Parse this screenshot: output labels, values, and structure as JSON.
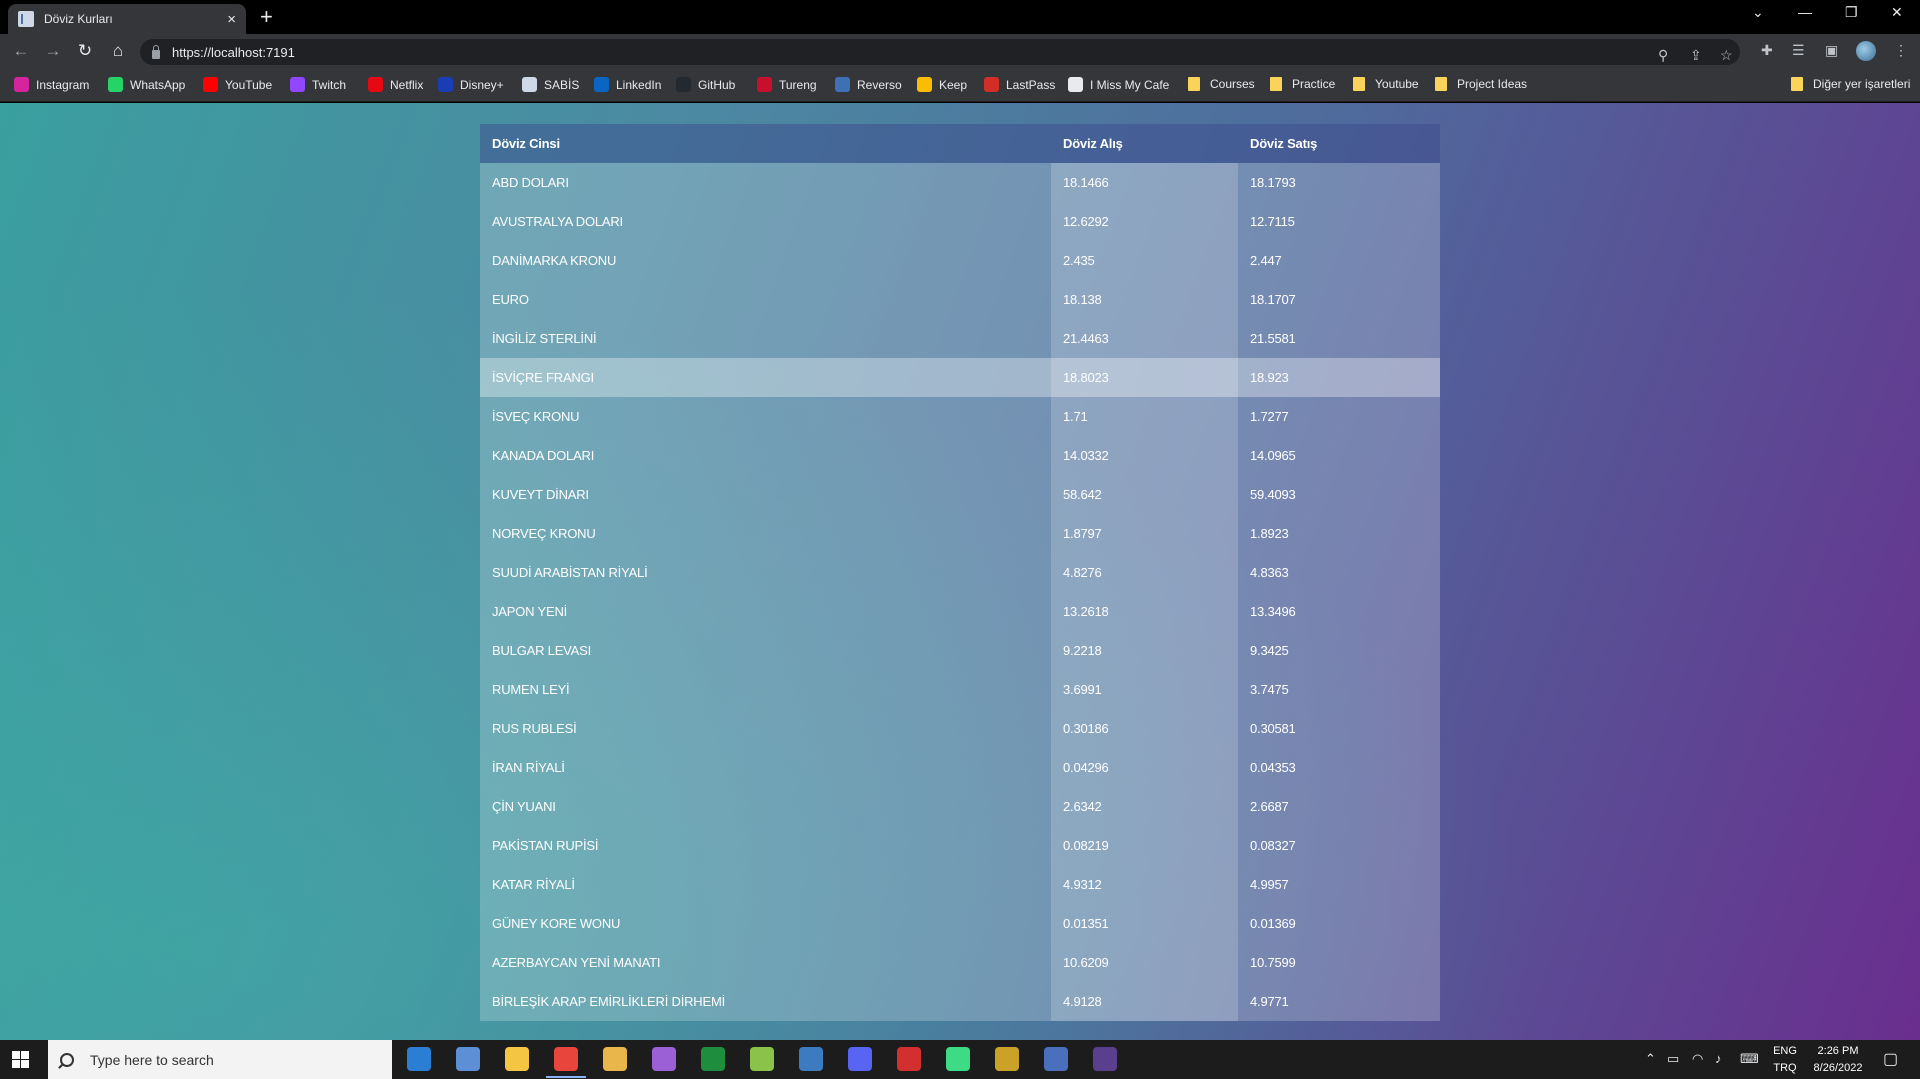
{
  "browser": {
    "tab_title": "Döviz Kurları",
    "tab_close": "×",
    "new_tab": "+",
    "url": "https://localhost:7191",
    "window_controls": {
      "dropdown": "⌄",
      "minimize": "—",
      "restore": "❐",
      "close": "✕"
    }
  },
  "bookmarks": [
    {
      "label": "Instagram",
      "icon": "instagram-icon",
      "color": "#d6249f"
    },
    {
      "label": "WhatsApp",
      "icon": "whatsapp-icon",
      "color": "#25d366"
    },
    {
      "label": "YouTube",
      "icon": "youtube-icon",
      "color": "#ff0000"
    },
    {
      "label": "Twitch",
      "icon": "twitch-icon",
      "color": "#9146ff"
    },
    {
      "label": "Netflix",
      "icon": "netflix-icon",
      "color": "#e50914"
    },
    {
      "label": "Disney+",
      "icon": "disney-icon",
      "color": "#1a3cb5"
    },
    {
      "label": "SABİS",
      "icon": "document-icon",
      "color": "#cfd8e6"
    },
    {
      "label": "LinkedIn",
      "icon": "linkedin-icon",
      "color": "#0a66c2"
    },
    {
      "label": "GitHub",
      "icon": "github-icon",
      "color": "#24292f"
    },
    {
      "label": "Tureng",
      "icon": "tureng-icon",
      "color": "#c8102e"
    },
    {
      "label": "Reverso",
      "icon": "reverso-icon",
      "color": "#3f6fb5"
    },
    {
      "label": "Keep",
      "icon": "keep-icon",
      "color": "#fbbc04"
    },
    {
      "label": "LastPass",
      "icon": "lastpass-icon",
      "color": "#d32d27"
    },
    {
      "label": "I Miss My Cafe",
      "icon": "cafe-icon",
      "color": "#e8eaed"
    },
    {
      "label": "Courses",
      "icon": "folder-icon",
      "color": "#f9d35a"
    },
    {
      "label": "Practice",
      "icon": "folder-icon",
      "color": "#f9d35a"
    },
    {
      "label": "Youtube",
      "icon": "folder-icon",
      "color": "#f9d35a"
    },
    {
      "label": "Project Ideas",
      "icon": "folder-icon",
      "color": "#f9d35a"
    }
  ],
  "other_bookmarks": "Diğer yer işaretleri",
  "table": {
    "headers": [
      "Döviz Cinsi",
      "Döviz Alış",
      "Döviz Satış"
    ],
    "highlighted_row": 5,
    "rows": [
      [
        "ABD DOLARI",
        "18.1466",
        "18.1793"
      ],
      [
        "AVUSTRALYA DOLARI",
        "12.6292",
        "12.7115"
      ],
      [
        "DANİMARKA KRONU",
        "2.435",
        "2.447"
      ],
      [
        "EURO",
        "18.138",
        "18.1707"
      ],
      [
        "İNGİLİZ STERLİNİ",
        "21.4463",
        "21.5581"
      ],
      [
        "İSVİÇRE FRANGI",
        "18.8023",
        "18.923"
      ],
      [
        "İSVEÇ KRONU",
        "1.71",
        "1.7277"
      ],
      [
        "KANADA DOLARI",
        "14.0332",
        "14.0965"
      ],
      [
        "KUVEYT DİNARI",
        "58.642",
        "59.4093"
      ],
      [
        "NORVEÇ KRONU",
        "1.8797",
        "1.8923"
      ],
      [
        "SUUDİ ARABİSTAN RİYALİ",
        "4.8276",
        "4.8363"
      ],
      [
        "JAPON YENİ",
        "13.2618",
        "13.3496"
      ],
      [
        "BULGAR LEVASI",
        "9.2218",
        "9.3425"
      ],
      [
        "RUMEN LEYİ",
        "3.6991",
        "3.7475"
      ],
      [
        "RUS RUBLESİ",
        "0.30186",
        "0.30581"
      ],
      [
        "İRAN RİYALİ",
        "0.04296",
        "0.04353"
      ],
      [
        "ÇİN YUANI",
        "2.6342",
        "2.6687"
      ],
      [
        "PAKİSTAN RUPİSİ",
        "0.08219",
        "0.08327"
      ],
      [
        "KATAR RİYALİ",
        "4.9312",
        "4.9957"
      ],
      [
        "GÜNEY KORE WONU",
        "0.01351",
        "0.01369"
      ],
      [
        "AZERBAYCAN YENİ MANATI",
        "10.6209",
        "10.7599"
      ],
      [
        "BİRLEŞİK ARAP EMİRLİKLERİ DİRHEMİ",
        "4.9128",
        "4.9771"
      ]
    ]
  },
  "taskbar": {
    "search_placeholder": "Type here to search",
    "apps": [
      {
        "name": "mail-icon",
        "color": "#2a7fd4"
      },
      {
        "name": "ide-icon",
        "color": "#5c8fd6"
      },
      {
        "name": "file-explorer-icon",
        "color": "#f4c542"
      },
      {
        "name": "chrome-icon",
        "color": "#e8453c",
        "running": true
      },
      {
        "name": "tool-icon",
        "color": "#e8b64a"
      },
      {
        "name": "visual-studio-icon",
        "color": "#9b5fd6"
      },
      {
        "name": "excel-icon",
        "color": "#1e8e3e"
      },
      {
        "name": "notepad-icon",
        "color": "#8bc34a"
      },
      {
        "name": "steam-icon",
        "color": "#3c7bbf"
      },
      {
        "name": "discord-icon",
        "color": "#5865f2"
      },
      {
        "name": "red-app-icon",
        "color": "#d32f2f"
      },
      {
        "name": "android-studio-icon",
        "color": "#3ddc84"
      },
      {
        "name": "globe-app-icon",
        "color": "#c9a227"
      },
      {
        "name": "remote-desktop-icon",
        "color": "#4a6fbd"
      },
      {
        "name": "terminal-icon",
        "color": "#5a3f8f"
      }
    ],
    "language": "ENG",
    "keyboard": "TRQ",
    "time": "2:26 PM",
    "date": "8/26/2022"
  }
}
